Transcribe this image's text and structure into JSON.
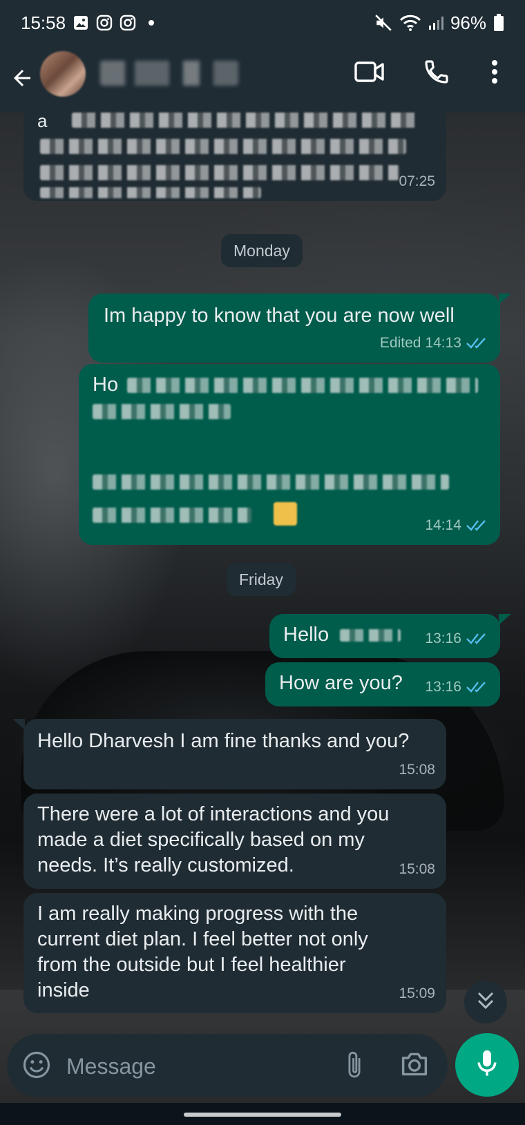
{
  "status_bar": {
    "time": "15:58",
    "battery": "96%",
    "icons": [
      "gallery-icon",
      "instagram-icon",
      "instagram-icon",
      "notification-dot",
      "mute-icon",
      "wifi-icon",
      "signal-icon",
      "battery-icon"
    ]
  },
  "header": {
    "contact_name": "",
    "icons": [
      "back-arrow-icon",
      "video-call-icon",
      "voice-call-icon",
      "more-options-icon"
    ]
  },
  "messages": [
    {
      "direction": "incoming",
      "text": "",
      "time": "07:25",
      "redacted": true
    },
    {
      "type": "date",
      "label": "Monday"
    },
    {
      "direction": "outgoing",
      "text": "Im happy to know that you are now well",
      "edited": "Edited",
      "time": "14:13",
      "status": "read"
    },
    {
      "direction": "outgoing",
      "text": "",
      "time": "14:14",
      "status": "read",
      "redacted": true
    },
    {
      "type": "date",
      "label": "Friday"
    },
    {
      "direction": "outgoing",
      "text": "Hello",
      "time": "13:16",
      "status": "read"
    },
    {
      "direction": "outgoing",
      "text": "How are you?",
      "time": "13:16",
      "status": "read"
    },
    {
      "direction": "incoming",
      "text": "Hello Dharvesh I am fine thanks and you?",
      "time": "15:08"
    },
    {
      "direction": "incoming",
      "text": "There were a lot of interactions and you made a diet specifically based on my needs. It’s really customized.",
      "time": "15:08"
    },
    {
      "direction": "incoming",
      "text": "I am really making progress with the current diet plan. I feel better not only from the outside but I feel healthier inside",
      "time": "15:09"
    }
  ],
  "composer": {
    "placeholder": "Message"
  },
  "colors": {
    "header_bg": "#1f2c34",
    "incoming_bubble": "#202c33",
    "outgoing_bubble": "#005c4b",
    "accent": "#00a884",
    "read_ticks": "#53bdeb"
  }
}
